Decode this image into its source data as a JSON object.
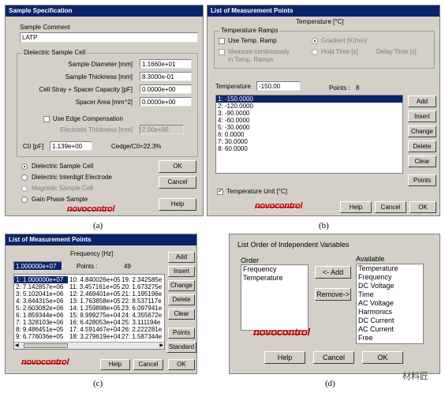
{
  "a": {
    "title": "Sample Specification",
    "comment_label": "Sample Comment",
    "comment_value": "LATP",
    "cell_group": "Dielectric Sample Cell",
    "rows": [
      {
        "label": "Sample Diameter [mm]",
        "value": "1.1660e+01"
      },
      {
        "label": "Sample Thickness [mm]",
        "value": "8.3000e-01"
      },
      {
        "label": "Cell Stray + Spacer Capacity [pF]",
        "value": "0.0000e+00"
      },
      {
        "label": "Spacer Area [mm^2]",
        "value": "0.0000e+00"
      }
    ],
    "edge_comp": "Use Edge Compensation",
    "electrode_label": "Electrode Thickness [mm]",
    "electrode_value": "2.00e+00",
    "c0_label": "C0 [pF]",
    "c0_value": "1.139e+00",
    "cedge": "Cedge/C0=22.3%",
    "options": [
      "Dielectric Sample Cell",
      "Dielectric Interdigit Electrode",
      "Magnetic Sample Cell",
      "Gain Phase Sample"
    ],
    "ok": "OK",
    "cancel": "Cancel",
    "help": "Help",
    "logo": "novocontrol",
    "caption": "(a)"
  },
  "b": {
    "title": "List of Measurement Points",
    "header": "Temperature [°C]",
    "ramps_group": "Temperature Ramps",
    "use_ramp": "Use Temp. Ramp",
    "measure_cont": "Measure continuously in Temp. Ramps",
    "gradient": "Gradient [K/min]",
    "hold_time": "Hold Time [s]",
    "delay_time": "Delay Time [s]",
    "temp_label": "Temperature",
    "temp_value": "-150.00",
    "points_label": "Points :",
    "points_value": "8",
    "items": [
      "1: -150.0000",
      "2: -120.0000",
      "3: -90.0000",
      "4: -60.0000",
      "5: -30.0000",
      "6: 0.0000",
      "7: 30.0000",
      "8: 60.0000"
    ],
    "buttons": [
      "Add",
      "Insert",
      "Change",
      "Delete",
      "Clear",
      "Points"
    ],
    "temp_unit": "Temperature Unit [°C]",
    "logo": "novocontrol",
    "help": "Help",
    "cancel": "Cancel",
    "ok": "OK",
    "caption": "(b)"
  },
  "c": {
    "title": "List of Measurement Points",
    "header": "Frequency [Hz]",
    "field_value": "1.000000e+07",
    "points_label": "Points :",
    "points_value": "49",
    "col1": [
      "1: 1.000000e+07",
      "2: 7.142857e+06",
      "3: 5.102041e+06",
      "4: 3.644315e+06",
      "5: 2.603082e+06",
      "6: 1.859344e+06",
      "7: 1.328103e+06",
      "8: 9.486451e+05",
      "9: 6.776036e+05"
    ],
    "col2": [
      "10: 4.840026e+05",
      "11: 3.457161e+05",
      "12: 2.469401e+05",
      "13: 1.763858e+05",
      "14: 1.259898e+05",
      "15: 8.999275e+04",
      "16: 6.428053e+04",
      "17: 4.591467e+04",
      "18: 3.279619e+04"
    ],
    "col3": [
      "19: 2.342585e",
      "20: 1.673275e",
      "21: 1.195196e",
      "22: 8.537117e",
      "23: 6.097941e",
      "24: 4.355672e",
      "25: 3.111194e",
      "26: 2.222281e",
      "27: 1.587344e"
    ],
    "buttons": [
      "Add",
      "Insert",
      "Change",
      "Delete",
      "Clear",
      "Points",
      "Standard"
    ],
    "logo": "novocontrol",
    "help": "Help",
    "cancel": "Cancel",
    "ok": "OK",
    "caption": "(c)"
  },
  "d": {
    "title": "List Order of Independent Variables",
    "order_label": "Order",
    "order_items": [
      "Frequency",
      "Temperature"
    ],
    "available_label": "Available",
    "available_items": [
      "Temperature",
      "Frequency",
      "DC Voltage",
      "Time",
      "AC Voltage",
      "Harmonics",
      "DC Current",
      "AC Current",
      "Free"
    ],
    "add": "<- Add",
    "remove": "Remove->",
    "logo": "novocontrol",
    "help": "Help",
    "cancel": "Cancel",
    "ok": "OK",
    "caption": "(d)",
    "watermark": "材料匠"
  }
}
